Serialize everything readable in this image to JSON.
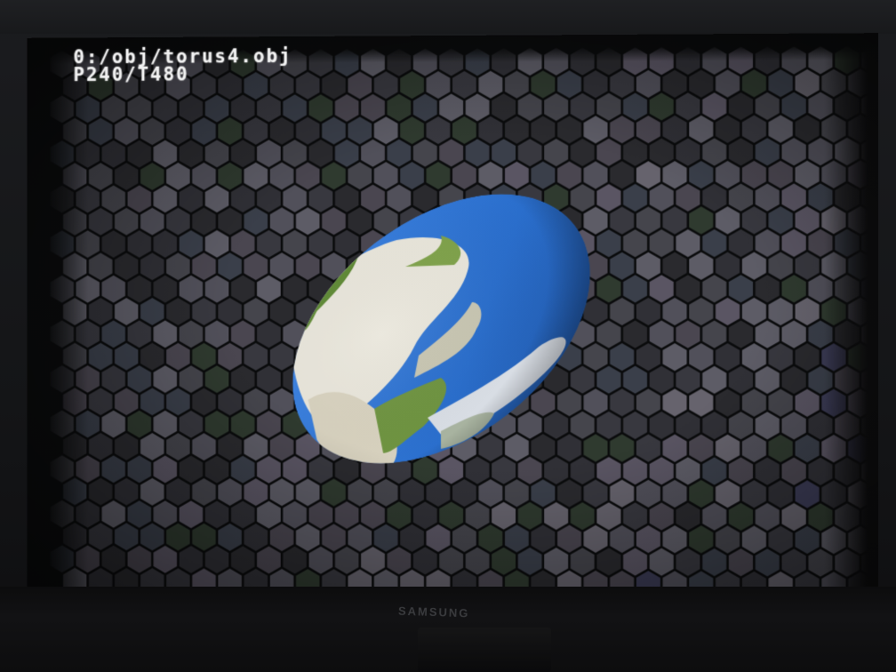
{
  "screen": {
    "file_path": "0:/obj/torus4.obj",
    "stats": "P240/T480"
  },
  "monitor": {
    "brand": "SAMSUNG"
  },
  "colors": {
    "ocean": "#2a6fd0",
    "land_green": "#4a7a2a",
    "ice": "#e6e2d6",
    "hex_dark": "#2b2b30"
  }
}
